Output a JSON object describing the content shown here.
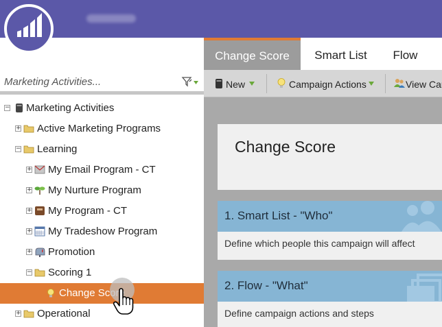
{
  "header": {
    "logo_icon": "marketo-logo",
    "account_name": ""
  },
  "sidebar": {
    "search": {
      "placeholder": "Marketing Activities...",
      "value": ""
    },
    "filter_icon": "filter-funnel-icon",
    "tree": [
      {
        "label": "Marketing Activities",
        "icon": "database-icon",
        "level": 0,
        "expander": "−"
      },
      {
        "label": "Active Marketing Programs",
        "icon": "folder-icon",
        "level": 1,
        "expander": "+"
      },
      {
        "label": "Learning",
        "icon": "folder-icon",
        "level": 1,
        "expander": "−"
      },
      {
        "label": "My Email Program - CT",
        "icon": "email-program-icon",
        "level": 2,
        "expander": "+"
      },
      {
        "label": "My Nurture Program",
        "icon": "nurture-program-icon",
        "level": 2,
        "expander": "+"
      },
      {
        "label": "My Program - CT",
        "icon": "program-icon",
        "level": 2,
        "expander": "+"
      },
      {
        "label": "My Tradeshow Program",
        "icon": "calendar-icon",
        "level": 2,
        "expander": "+"
      },
      {
        "label": "Promotion",
        "icon": "mailbox-icon",
        "level": 2,
        "expander": "+"
      },
      {
        "label": "Scoring 1",
        "icon": "folder-icon",
        "level": 2,
        "expander": "−"
      },
      {
        "label": "Change Score",
        "icon": "lightbulb-icon",
        "level": 3,
        "expander": "",
        "selected": true
      },
      {
        "label": "Operational",
        "icon": "folder-icon",
        "level": 1,
        "expander": "+"
      }
    ]
  },
  "tabs": [
    {
      "label": "Change Score",
      "active": true
    },
    {
      "label": "Smart List",
      "active": false
    },
    {
      "label": "Flow",
      "active": false
    }
  ],
  "toolbar": {
    "new_label": "New",
    "campaign_actions_label": "Campaign Actions",
    "view_label": "View Can"
  },
  "main": {
    "title": "Change Score",
    "steps": [
      {
        "title": "1. Smart List - \"Who\"",
        "description": "Define which people this campaign will affect",
        "icon": "people-icon"
      },
      {
        "title": "2. Flow - \"What\"",
        "description": "Define campaign actions and steps",
        "icon": "stacked-squares-icon"
      }
    ]
  },
  "colors": {
    "header": "#5b58a8",
    "accent_orange": "#e07b34",
    "step_header_blue": "#86b5d4",
    "active_tab": "#9c9c9c"
  }
}
